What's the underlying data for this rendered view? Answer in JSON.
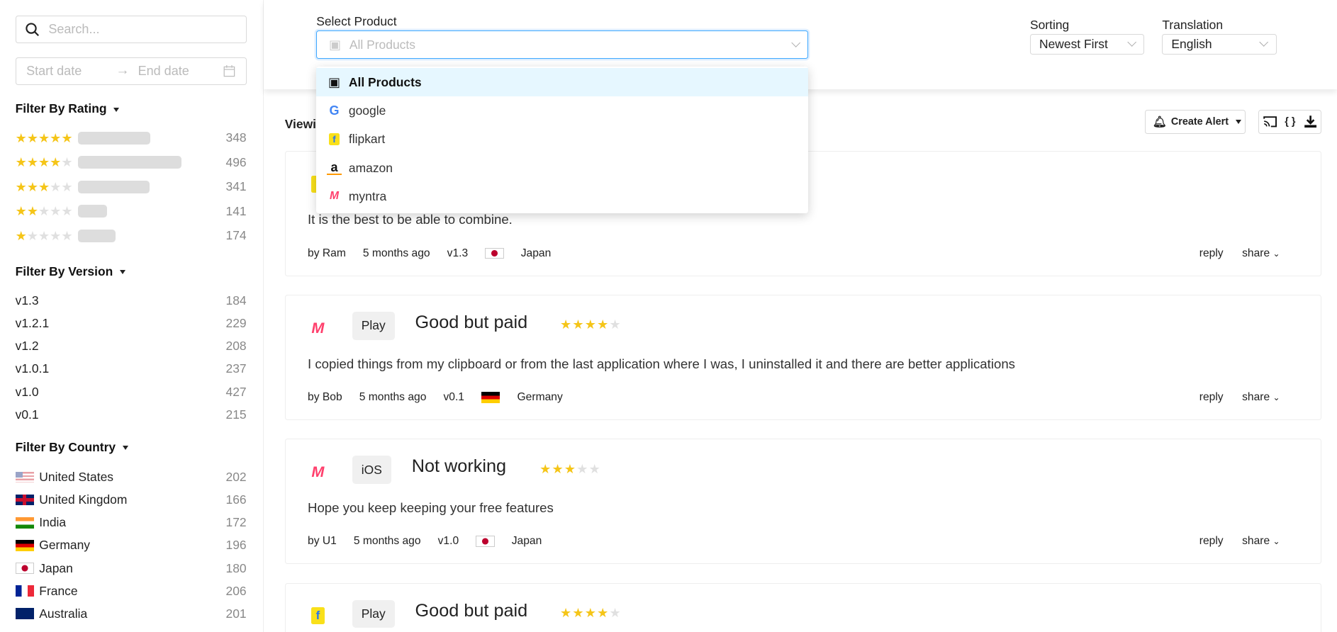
{
  "sidebar": {
    "search_placeholder": "Search...",
    "date_start": "Start date",
    "date_end": "End date",
    "rating": {
      "title": "Filter By Rating",
      "items": [
        {
          "stars": 5,
          "count": "348",
          "fill": 0.7
        },
        {
          "stars": 4,
          "count": "496",
          "fill": 1.0
        },
        {
          "stars": 3,
          "count": "341",
          "fill": 0.69
        },
        {
          "stars": 2,
          "count": "141",
          "fill": 0.28
        },
        {
          "stars": 1,
          "count": "174",
          "fill": 0.36
        }
      ]
    },
    "version": {
      "title": "Filter By Version",
      "items": [
        {
          "label": "v1.3",
          "count": "184"
        },
        {
          "label": "v1.2.1",
          "count": "229"
        },
        {
          "label": "v1.2",
          "count": "208"
        },
        {
          "label": "v1.0.1",
          "count": "237"
        },
        {
          "label": "v1.0",
          "count": "427"
        },
        {
          "label": "v0.1",
          "count": "215"
        }
      ]
    },
    "country": {
      "title": "Filter By Country",
      "items": [
        {
          "label": "United States",
          "count": "202",
          "flag": "us"
        },
        {
          "label": "United Kingdom",
          "count": "166",
          "flag": "gb"
        },
        {
          "label": "India",
          "count": "172",
          "flag": "in"
        },
        {
          "label": "Germany",
          "count": "196",
          "flag": "de"
        },
        {
          "label": "Japan",
          "count": "180",
          "flag": "jp"
        },
        {
          "label": "France",
          "count": "206",
          "flag": "fr"
        },
        {
          "label": "Australia",
          "count": "201",
          "flag": "au"
        }
      ]
    }
  },
  "header": {
    "product_label": "Select Product",
    "product_value": "All Products",
    "sorting_label": "Sorting",
    "sorting_value": "Newest First",
    "translation_label": "Translation",
    "translation_value": "English"
  },
  "dropdown": {
    "options": [
      {
        "label": "All Products",
        "icon": "box-icon",
        "active": true
      },
      {
        "label": "google",
        "icon": "google-icon"
      },
      {
        "label": "flipkart",
        "icon": "flipkart-icon"
      },
      {
        "label": "amazon",
        "icon": "amazon-icon"
      },
      {
        "label": "myntra",
        "icon": "myntra-icon"
      }
    ]
  },
  "toolbar": {
    "viewing": "Viewing",
    "create_alert": "Create Alert"
  },
  "reviews": [
    {
      "product": "flipkart",
      "store": "",
      "title": "",
      "rating": 0,
      "text": "It is the best to be able to combine.",
      "author": "by Ram",
      "time": "5 months ago",
      "version": "v1.3",
      "country": "Japan",
      "flag": "jp"
    },
    {
      "product": "myntra",
      "store": "Play",
      "title": "Good but paid",
      "rating": 4,
      "text": "I copied things from my clipboard or from the last application where I was, I uninstalled it and there are better applications",
      "author": "by Bob",
      "time": "5 months ago",
      "version": "v0.1",
      "country": "Germany",
      "flag": "de"
    },
    {
      "product": "myntra",
      "store": "iOS",
      "title": "Not working",
      "rating": 3,
      "text": "Hope you keep keeping your free features",
      "author": "by U1",
      "time": "5 months ago",
      "version": "v1.0",
      "country": "Japan",
      "flag": "jp"
    },
    {
      "product": "flipkart",
      "store": "Play",
      "title": "Good but paid",
      "rating": 4
    }
  ],
  "actions": {
    "reply": "reply",
    "share": "share"
  },
  "colors": {
    "star": "#f5c518",
    "accent": "#40a9ff",
    "active_option": "#e6f7ff"
  }
}
